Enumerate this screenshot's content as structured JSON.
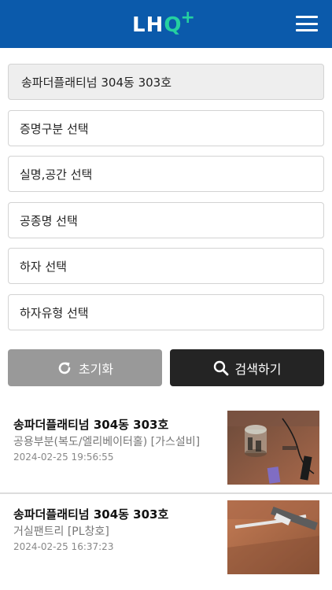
{
  "header": {
    "logo_main": "LH",
    "logo_q": "Q",
    "logo_plus": "+",
    "brand_color": "#0b5aab",
    "accent_color": "#25d0a0",
    "menu_icon": "hamburger-menu-icon"
  },
  "form": {
    "unit": "송파더플래티넘 304동 303호",
    "cert_type": "증명구분 선택",
    "room_space": "실명,공간 선택",
    "work_type": "공종명 선택",
    "defect": "하자 선택",
    "defect_type": "하자유형 선택"
  },
  "buttons": {
    "reset_label": "초기화",
    "reset_icon": "refresh-icon",
    "search_label": "검색하기",
    "search_icon": "search-icon"
  },
  "results": [
    {
      "title": "송파더플래티넘 304동 303호",
      "subtitle": "공용부분(복도/엘리베이터홀) [가스설비]",
      "date": "2024-02-25 19:56:55",
      "thumbnail": "photo-thumbnail"
    },
    {
      "title": "송파더플래티넘 304동 303호",
      "subtitle": "거실팬트리 [PL창호]",
      "date": "2024-02-25 16:37:23",
      "thumbnail": "photo-thumbnail"
    }
  ]
}
